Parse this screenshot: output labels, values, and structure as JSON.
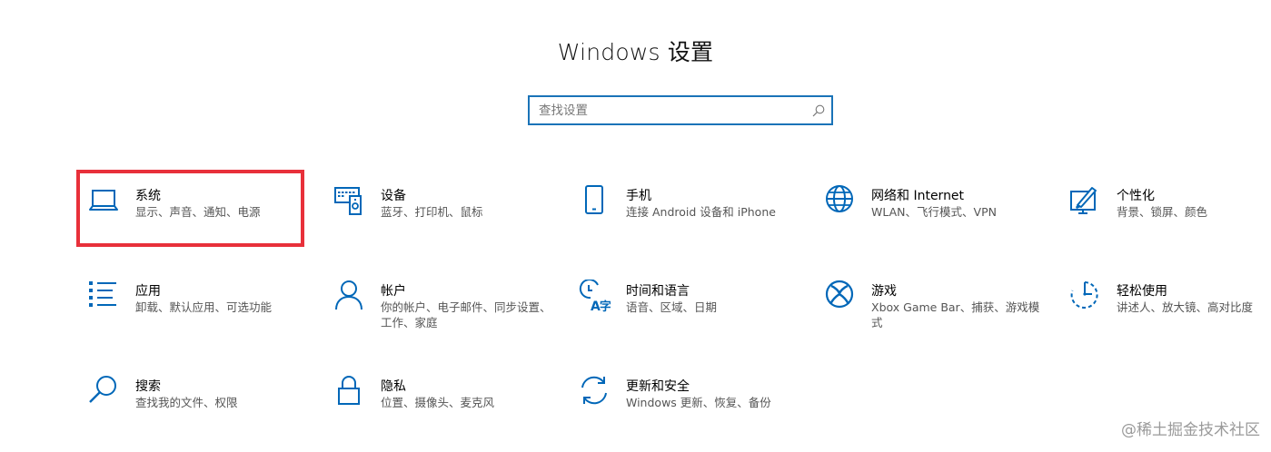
{
  "header": {
    "title": "Windows 设置"
  },
  "search": {
    "placeholder": "查找设置"
  },
  "tiles": [
    {
      "id": "system",
      "name": "系统",
      "desc": "显示、声音、通知、电源",
      "icon": "laptop-icon"
    },
    {
      "id": "devices",
      "name": "设备",
      "desc": "蓝牙、打印机、鼠标",
      "icon": "devices-icon"
    },
    {
      "id": "phone",
      "name": "手机",
      "desc": "连接 Android 设备和 iPhone",
      "icon": "phone-icon"
    },
    {
      "id": "network",
      "name": "网络和 Internet",
      "desc": "WLAN、飞行模式、VPN",
      "icon": "globe-icon"
    },
    {
      "id": "personalization",
      "name": "个性化",
      "desc": "背景、锁屏、颜色",
      "icon": "paint-icon"
    },
    {
      "id": "apps",
      "name": "应用",
      "desc": "卸载、默认应用、可选功能",
      "icon": "apps-list-icon"
    },
    {
      "id": "accounts",
      "name": "帐户",
      "desc": "你的帐户、电子邮件、同步设置、工作、家庭",
      "icon": "person-icon"
    },
    {
      "id": "time",
      "name": "时间和语言",
      "desc": "语音、区域、日期",
      "icon": "time-language-icon"
    },
    {
      "id": "gaming",
      "name": "游戏",
      "desc": "Xbox Game Bar、捕获、游戏模式",
      "icon": "xbox-icon"
    },
    {
      "id": "ease",
      "name": "轻松使用",
      "desc": "讲述人、放大镜、高对比度",
      "icon": "ease-of-access-icon"
    },
    {
      "id": "search",
      "name": "搜索",
      "desc": "查找我的文件、权限",
      "icon": "search-icon"
    },
    {
      "id": "privacy",
      "name": "隐私",
      "desc": "位置、摄像头、麦克风",
      "icon": "lock-icon"
    },
    {
      "id": "update",
      "name": "更新和安全",
      "desc": "Windows 更新、恢复、备份",
      "icon": "sync-icon"
    }
  ],
  "watermark": "@稀土掘金技术社区",
  "colors": {
    "accent": "#0067b8",
    "highlight": "#e8303a",
    "border": "#1a73b8"
  }
}
